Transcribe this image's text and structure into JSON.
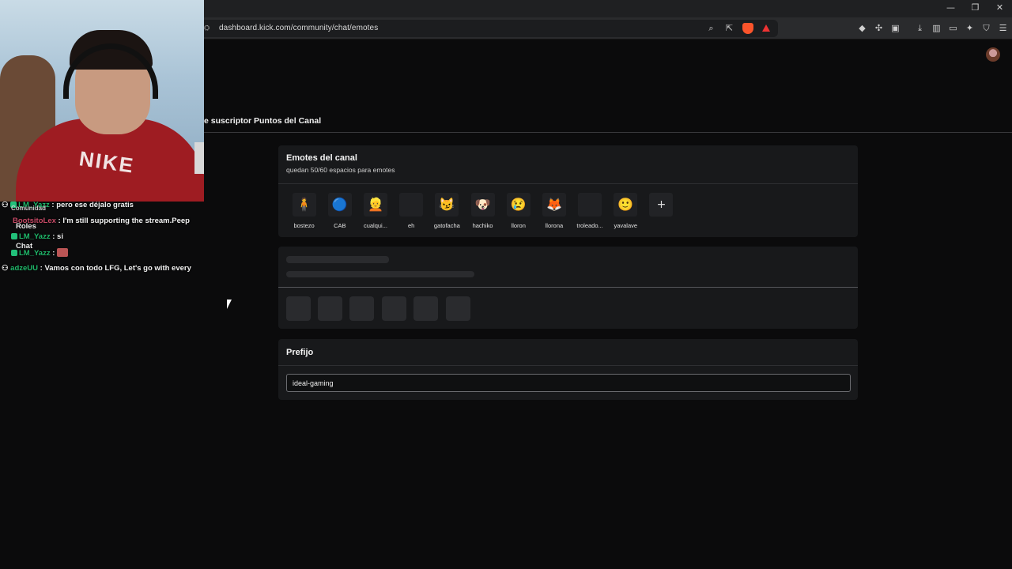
{
  "browser": {
    "url": "dashboard.kick.com/community/chat/emotes",
    "window_controls": [
      "—",
      "❐",
      "✕"
    ],
    "toolbar_icons": [
      "zoom-icon",
      "share-icon",
      "brave-shields-icon",
      "brave-rewards-icon"
    ],
    "extension_icons": [
      "extension-a-icon",
      "puzzle-icon",
      "screenshot-icon",
      "download-icon",
      "sidebar-icon",
      "wallet-icon",
      "leo-icon",
      "vpn-icon",
      "menu-icon"
    ]
  },
  "tabs": [
    {
      "label": "e suscriptor"
    },
    {
      "label": "Puntos del Canal"
    }
  ],
  "emotes_card": {
    "title": "Emotes del canal",
    "subtitle": "quedan 50/60 espacios para emotes",
    "emotes": [
      {
        "label": "bostezo",
        "glyph": "🧍"
      },
      {
        "label": "CAB",
        "glyph": "🔵"
      },
      {
        "label": "cualqui...",
        "glyph": "👱"
      },
      {
        "label": "eh",
        "glyph": ""
      },
      {
        "label": "gatofacha",
        "glyph": "😼"
      },
      {
        "label": "hachiko",
        "glyph": "🐶"
      },
      {
        "label": "lloron",
        "glyph": "😢"
      },
      {
        "label": "llorona",
        "glyph": "🦊"
      },
      {
        "label": "troleado...",
        "glyph": ""
      },
      {
        "label": "yavalave",
        "glyph": "🙂"
      }
    ],
    "add_label": "+"
  },
  "prefix_card": {
    "title": "Prefijo",
    "value": "ideal-gaming"
  },
  "overlay_chat": {
    "lines": [
      {
        "user": "LM_Yazz",
        "text": ": pero ese déjalo gratis",
        "red": false
      },
      {
        "user": "BootsitoLex",
        "text": ": I'm still supporting the stream.Peep",
        "red": true
      },
      {
        "user": "LM_Yazz",
        "text": ": si",
        "red": false
      },
      {
        "user": "LM_Yazz",
        "text": ":",
        "red": false
      },
      {
        "user": "adzeUU",
        "text": ": Vamos con todo LFG, Let's go with every",
        "red": false
      }
    ],
    "roles_label": "Roles",
    "chat_label": "Chat",
    "community_label": "Comunidad"
  },
  "colors": {
    "accent_green": "#1fb86a",
    "background": "#0b0b0c",
    "card": "#18191b"
  }
}
